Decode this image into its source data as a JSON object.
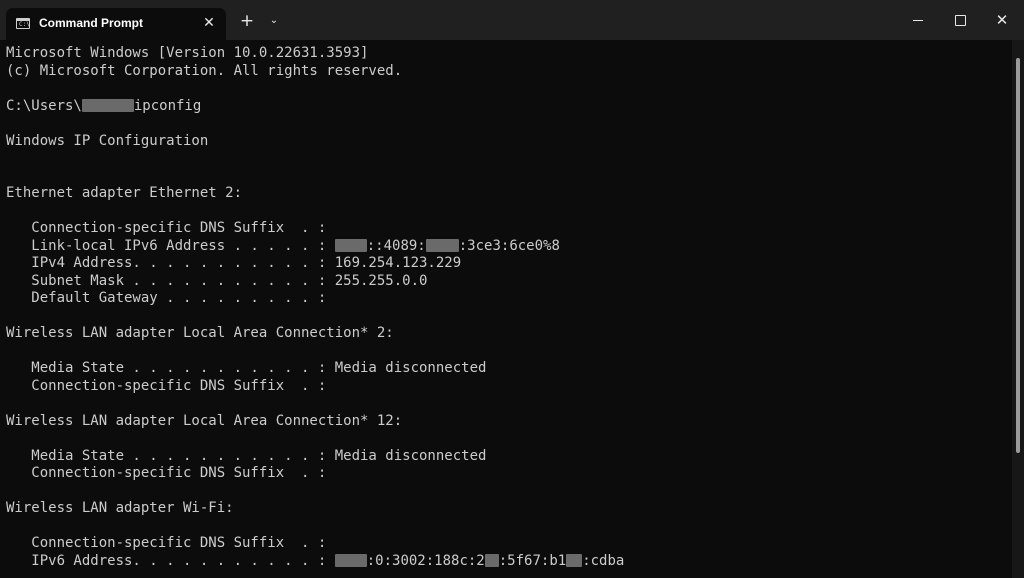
{
  "window": {
    "tab_title": "Command Prompt",
    "tab_icon": "cmd-icon",
    "tab_icon_text": "C:\\",
    "close_tab_icon": "close-icon",
    "new_tab_icon": "plus-icon",
    "dropdown_icon": "chevron-down-icon",
    "minimize_icon": "minimize-icon",
    "maximize_icon": "maximize-icon",
    "close_window_icon": "close-icon",
    "close_glyph": "✕",
    "new_tab_glyph": "+",
    "dropdown_glyph": "⌄"
  },
  "console": {
    "version_line": "Microsoft Windows [Version 10.0.22631.3593]",
    "copyright_line": "(c) Microsoft Corporation. All rights reserved.",
    "prompt_prefix": "C:\\Users\\",
    "prompt_command": "ipconfig",
    "config_heading": "Windows IP Configuration",
    "ethernet_heading": "Ethernet adapter Ethernet 2:",
    "eth_dns_suffix": "   Connection-specific DNS Suffix  . :",
    "eth_ipv6_label": "   Link-local IPv6 Address . . . . . : ",
    "eth_ipv6_part1": "::4089:",
    "eth_ipv6_part2": ":3ce3:6ce0%8",
    "eth_ipv4": "   IPv4 Address. . . . . . . . . . . : 169.254.123.229",
    "eth_subnet": "   Subnet Mask . . . . . . . . . . . : 255.255.0.0",
    "eth_gateway": "   Default Gateway . . . . . . . . . :",
    "wlan2_heading": "Wireless LAN adapter Local Area Connection* 2:",
    "wlan2_media": "   Media State . . . . . . . . . . . : Media disconnected",
    "wlan2_dns": "   Connection-specific DNS Suffix  . :",
    "wlan12_heading": "Wireless LAN adapter Local Area Connection* 12:",
    "wlan12_media": "   Media State . . . . . . . . . . . : Media disconnected",
    "wlan12_dns": "   Connection-specific DNS Suffix  . :",
    "wifi_heading": "Wireless LAN adapter Wi-Fi:",
    "wifi_dns": "   Connection-specific DNS Suffix  . :",
    "wifi_ipv6_label": "   IPv6 Address. . . . . . . . . . . : ",
    "wifi_ipv6_part1": ":0:3002:188c:2",
    "wifi_ipv6_part2": ":5f67:b1",
    "wifi_ipv6_part3": ":cdba"
  },
  "colors": {
    "console_bg": "#0c0c0c",
    "titlebar_bg": "#202020",
    "text": "#cccccc",
    "redaction": "#6a6a6a"
  }
}
